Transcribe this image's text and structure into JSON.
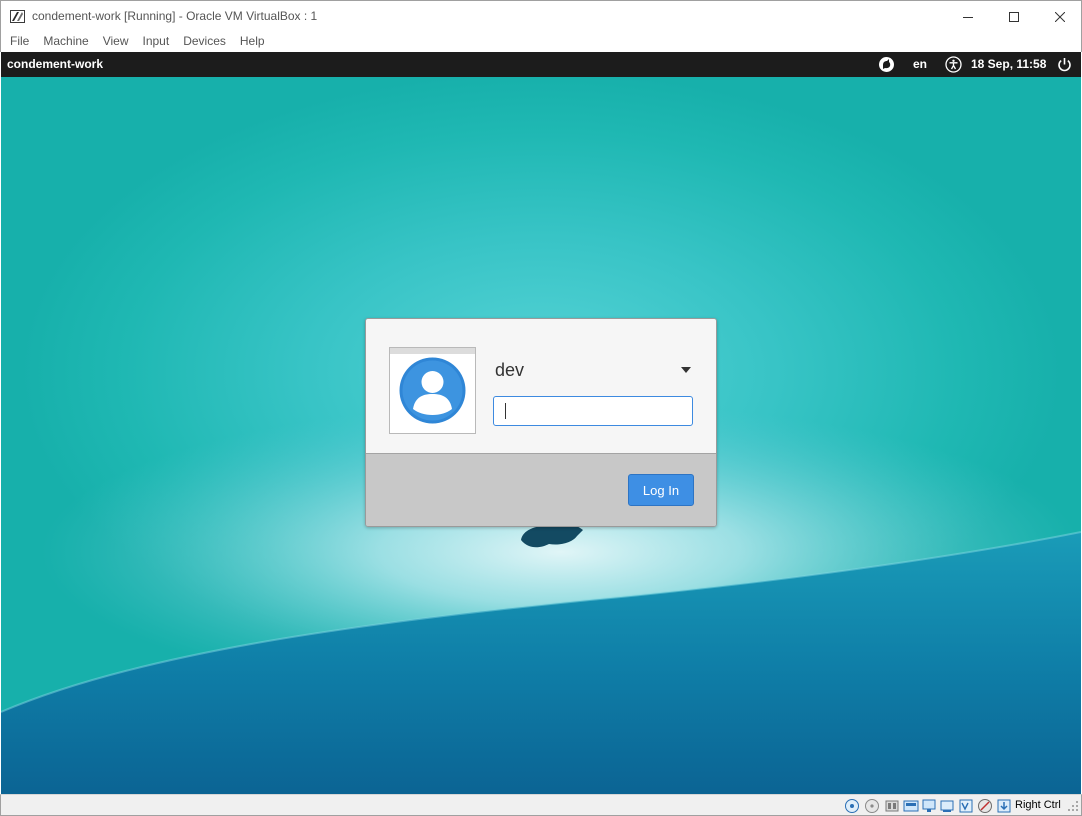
{
  "window": {
    "title": "condement-work [Running] - Oracle VM VirtualBox : 1",
    "controls": [
      "minimize",
      "maximize",
      "close"
    ]
  },
  "menu": {
    "items": [
      "File",
      "Machine",
      "View",
      "Input",
      "Devices",
      "Help"
    ]
  },
  "vm": {
    "panel": {
      "hostname": "condement-work",
      "keyboard_layout": "en",
      "datetime": "18 Sep, 11:58",
      "icons": [
        "onboard-keyboard-icon",
        "accessibility-icon",
        "power-icon"
      ]
    },
    "login": {
      "username": "dev",
      "password_value": "",
      "login_button": "Log In"
    }
  },
  "statusbar": {
    "host_key": "Right Ctrl",
    "icons": [
      "hard-disk-icon",
      "optical-drive-icon",
      "audio-icon",
      "network-icon",
      "usb-icon",
      "shared-folders-icon",
      "display-icon",
      "video-capture-icon",
      "virtualization-icon",
      "mouse-integration-icon",
      "host-key-arrow-icon"
    ]
  },
  "colors": {
    "accent": "#3e8fe4",
    "panel_bg": "#1c1c1c",
    "wallpaper_teal": "#1fb8b3",
    "wallpaper_deep": "#0e6e9a"
  }
}
